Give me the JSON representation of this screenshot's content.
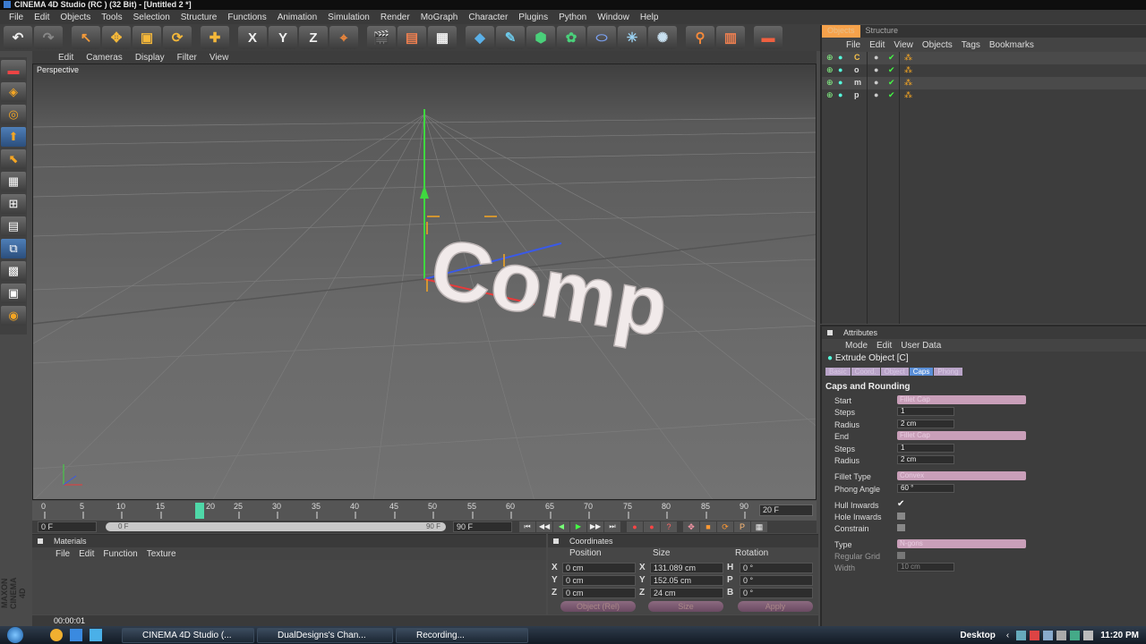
{
  "window": {
    "title": "CINEMA 4D Studio (RC ) (32 Bit) - [Untitled 2 *]"
  },
  "menubar": [
    "File",
    "Edit",
    "Objects",
    "Tools",
    "Selection",
    "Structure",
    "Functions",
    "Animation",
    "Simulation",
    "Render",
    "MoGraph",
    "Character",
    "Plugins",
    "Python",
    "Window",
    "Help"
  ],
  "toolbar": {
    "icons": [
      "undo-icon",
      "redo-icon",
      "live-select-icon",
      "move-icon",
      "scale-icon",
      "rotate-icon",
      "move-tool-icon",
      "x-axis-icon",
      "y-axis-icon",
      "z-axis-icon",
      "coordinate-system-icon",
      "render-view-icon",
      "render-picture-viewer-icon",
      "render-settings-icon",
      "cube-icon",
      "pen-spline-icon",
      "subdivision-surface-icon",
      "cloner-icon",
      "deformer-icon",
      "scene-icon",
      "environment-icon",
      "camera-icon",
      "light-icon"
    ],
    "axis_labels": [
      "X",
      "Y",
      "Z"
    ]
  },
  "viewport": {
    "menu": [
      "Edit",
      "Cameras",
      "Display",
      "Filter",
      "View"
    ],
    "label": "Perspective",
    "text_object": "Comp"
  },
  "timeline": {
    "ticks": [
      "0",
      "5",
      "10",
      "15",
      "20",
      "25",
      "30",
      "35",
      "40",
      "45",
      "50",
      "55",
      "60",
      "65",
      "70",
      "75",
      "80",
      "85",
      "90"
    ],
    "current_frame": "20",
    "frame_field": "20 F",
    "start": "0 F",
    "range_start": "0 F",
    "range_end": "90 F",
    "end": "90 F"
  },
  "materials": {
    "title": "Materials",
    "menu": [
      "File",
      "Edit",
      "Function",
      "Texture"
    ]
  },
  "coordinates": {
    "title": "Coordinates",
    "headers": [
      "Position",
      "Size",
      "Rotation"
    ],
    "rows": [
      {
        "axis": "X",
        "pos": "0 cm",
        "size_axis": "X",
        "size": "131.089 cm",
        "rot_axis": "H",
        "rot": "0 °"
      },
      {
        "axis": "Y",
        "pos": "0 cm",
        "size_axis": "Y",
        "size": "152.05 cm",
        "rot_axis": "P",
        "rot": "0 °"
      },
      {
        "axis": "Z",
        "pos": "0 cm",
        "size_axis": "Z",
        "size": "24 cm",
        "rot_axis": "B",
        "rot": "0 °"
      }
    ],
    "mode_select": "Object (Rel)",
    "size_select": "Size",
    "apply": "Apply"
  },
  "status": {
    "time": "00:00:01"
  },
  "object_manager": {
    "tabs": [
      "Objects",
      "Structure"
    ],
    "menu": [
      "File",
      "Edit",
      "View",
      "Objects",
      "Tags",
      "Bookmarks"
    ],
    "rows": [
      "C",
      "o",
      "m",
      "p"
    ]
  },
  "attributes": {
    "title": "Attributes",
    "menu": [
      "Mode",
      "Edit",
      "User Data"
    ],
    "object_name": "Extrude Object [C]",
    "tabs": [
      "Basic",
      "Coord.",
      "Object",
      "Caps",
      "Phong"
    ],
    "section": "Caps and Rounding",
    "start_label": "Start",
    "start_value": "Fillet Cap",
    "steps1_label": "Steps",
    "steps1_value": "1",
    "radius1_label": "Radius",
    "radius1_value": "2 cm",
    "end_label": "End",
    "end_value": "Fillet Cap",
    "steps2_label": "Steps",
    "steps2_value": "1",
    "radius2_label": "Radius",
    "radius2_value": "2 cm",
    "fillet_type_label": "Fillet Type",
    "fillet_type_value": "Convex",
    "phong_angle_label": "Phong Angle",
    "phong_angle_value": "60 °",
    "hull_inwards_label": "Hull Inwards",
    "hole_inwards_label": "Hole Inwards",
    "constrain_label": "Constrain",
    "type_label": "Type",
    "type_value": "N-gons",
    "regular_grid_label": "Regular Grid",
    "width_label": "Width",
    "width_value": "10 cm"
  },
  "taskbar": {
    "buttons": [
      "CINEMA 4D Studio (...",
      "DualDesigns's Chan...",
      "Recording..."
    ],
    "desktop": "Desktop",
    "clock": "11:20 PM"
  }
}
